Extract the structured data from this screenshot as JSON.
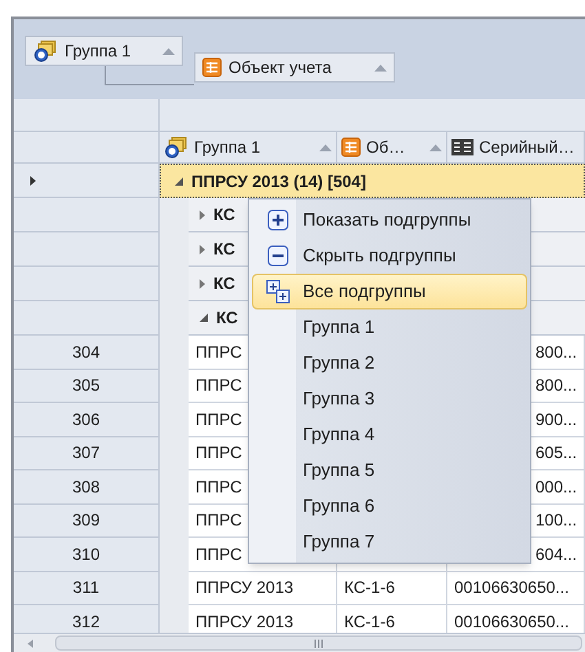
{
  "group_panel": {
    "chips": [
      {
        "label": "Группа 1",
        "sorted": true
      },
      {
        "label": "Объект учета",
        "sorted": true
      }
    ]
  },
  "columns": [
    {
      "label": "Группа 1",
      "sorted": true
    },
    {
      "label": "Об…",
      "sorted": true
    },
    {
      "label": "Серийный…",
      "sorted": false
    }
  ],
  "group_row": {
    "label": "ППРСУ 2013 (14) [504]",
    "expanded": true,
    "focused": true
  },
  "subgroups": [
    {
      "label": "КС",
      "expanded": false
    },
    {
      "label": "КС",
      "expanded": false
    },
    {
      "label": "КС",
      "expanded": false
    },
    {
      "label": "КС",
      "expanded": true
    }
  ],
  "rows": [
    {
      "number": "304",
      "cells": [
        "ППРС",
        "",
        "800..."
      ]
    },
    {
      "number": "305",
      "cells": [
        "ППРС",
        "",
        "800..."
      ]
    },
    {
      "number": "306",
      "cells": [
        "ППРС",
        "",
        "900..."
      ]
    },
    {
      "number": "307",
      "cells": [
        "ППРС",
        "",
        "605..."
      ]
    },
    {
      "number": "308",
      "cells": [
        "ППРС",
        "",
        "000..."
      ]
    },
    {
      "number": "309",
      "cells": [
        "ППРС",
        "",
        "100..."
      ]
    },
    {
      "number": "310",
      "cells": [
        "ППРС",
        "",
        "604..."
      ]
    },
    {
      "number": "311",
      "cells": [
        "ППРСУ 2013",
        "КС-1-6",
        "00106630650..."
      ]
    },
    {
      "number": "312",
      "cells": [
        "ППРСУ 2013",
        "КС-1-6",
        "00106630650..."
      ]
    }
  ],
  "context_menu": {
    "items": [
      {
        "kind": "command",
        "label": "Показать подгруппы",
        "selected": false
      },
      {
        "kind": "command",
        "label": "Скрыть подгруппы",
        "selected": false
      },
      {
        "kind": "command",
        "label": "Все подгруппы",
        "selected": true
      },
      {
        "kind": "group",
        "label": "Группа 1",
        "selected": false
      },
      {
        "kind": "group",
        "label": "Группа 2",
        "selected": false
      },
      {
        "kind": "group",
        "label": "Группа 3",
        "selected": false
      },
      {
        "kind": "group",
        "label": "Группа 4",
        "selected": false
      },
      {
        "kind": "group",
        "label": "Группа 5",
        "selected": false
      },
      {
        "kind": "group",
        "label": "Группа 6",
        "selected": false
      },
      {
        "kind": "group",
        "label": "Группа 7",
        "selected": false
      }
    ]
  }
}
